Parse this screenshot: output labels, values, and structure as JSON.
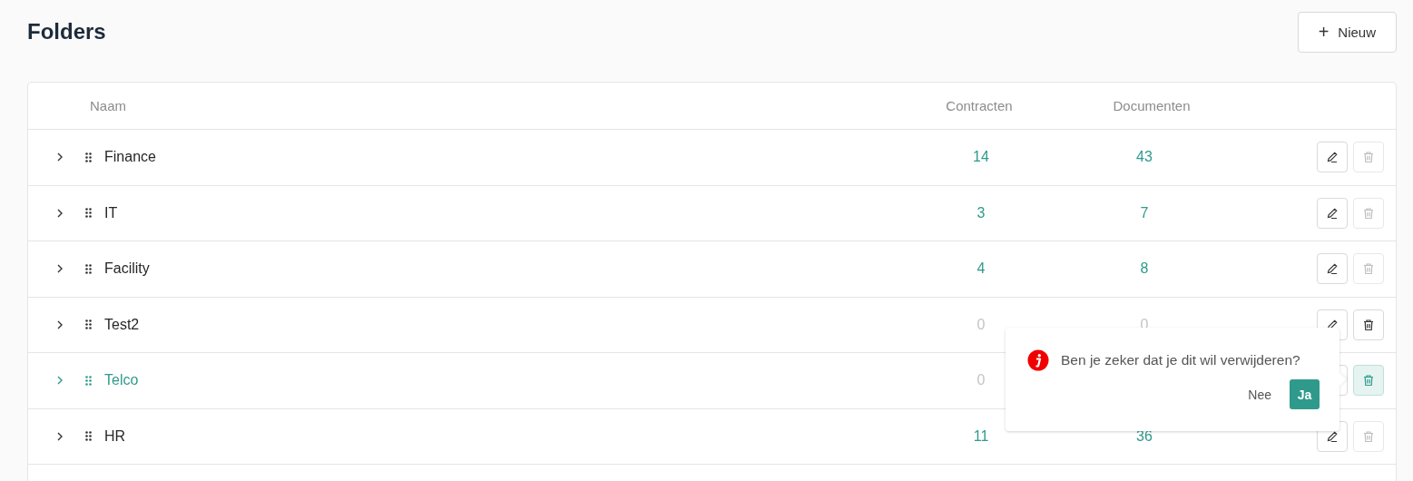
{
  "page": {
    "title": "Folders",
    "new_button": {
      "icon": "+",
      "label": "Nieuw"
    }
  },
  "table": {
    "columns": [
      "Naam",
      "Contracten",
      "Documenten"
    ],
    "rows": [
      {
        "name": "Finance",
        "selected": false,
        "contracts": {
          "value": "14",
          "muted": false
        },
        "documents": {
          "value": "43",
          "muted": false
        },
        "delete_disabled": true,
        "delete_active": false
      },
      {
        "name": "IT",
        "selected": false,
        "contracts": {
          "value": "3",
          "muted": false
        },
        "documents": {
          "value": "7",
          "muted": false
        },
        "delete_disabled": true,
        "delete_active": false
      },
      {
        "name": "Facility",
        "selected": false,
        "contracts": {
          "value": "4",
          "muted": false
        },
        "documents": {
          "value": "8",
          "muted": false
        },
        "delete_disabled": true,
        "delete_active": false
      },
      {
        "name": "Test2",
        "selected": false,
        "contracts": {
          "value": "0",
          "muted": true
        },
        "documents": {
          "value": "0",
          "muted": true
        },
        "delete_disabled": false,
        "delete_active": false
      },
      {
        "name": "Telco",
        "selected": true,
        "contracts": {
          "value": "0",
          "muted": true
        },
        "delete_disabled": false,
        "delete_active": true
      },
      {
        "name": "HR",
        "selected": false,
        "contracts": {
          "value": "11",
          "muted": false
        },
        "documents": {
          "value": "36",
          "muted": false
        },
        "delete_disabled": true,
        "delete_active": false
      }
    ]
  },
  "confirm_popover": {
    "message": "Ben je zeker dat je dit wil verwijderen?",
    "cancel": "Nee",
    "confirm": "Ja"
  }
}
